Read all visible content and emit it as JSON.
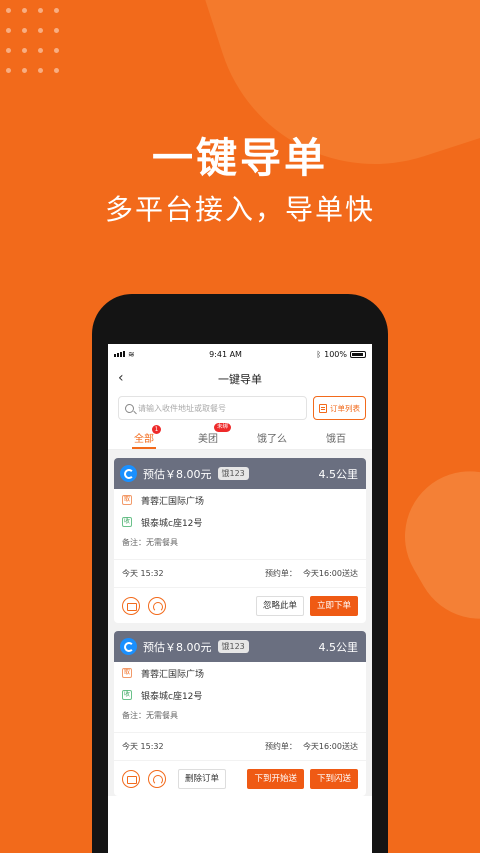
{
  "promo": {
    "headline": "一键导单",
    "subline": "多平台接入，导单快"
  },
  "status_bar": {
    "time": "9:41 AM",
    "battery": "100%"
  },
  "nav": {
    "title": "一键导单"
  },
  "search": {
    "placeholder": "请输入收件地址或取餐号",
    "order_list_label": "订单列表"
  },
  "tabs": [
    {
      "label": "全部",
      "badge": "1",
      "active": true
    },
    {
      "label": "美团",
      "badge": "未绑",
      "active": false
    },
    {
      "label": "饿了么",
      "badge": "",
      "active": false
    },
    {
      "label": "饿百",
      "badge": "",
      "active": false
    }
  ],
  "orders": [
    {
      "estimate": "预估￥8.00元",
      "platform_tag": "饿123",
      "distance": "4.5公里",
      "pickup_address": "菁蓉汇国际广场",
      "dropoff_address": "银泰城c座12号",
      "pickup_icon": "取",
      "dropoff_icon": "收",
      "note": "备注：无需餐具",
      "time": "今天 15:32",
      "reserve_label": "预约单：",
      "reserve_time": "今天16:00送达",
      "buttons": [
        "忽略此单",
        "立即下单"
      ]
    },
    {
      "estimate": "预估￥8.00元",
      "platform_tag": "饿123",
      "distance": "4.5公里",
      "pickup_address": "菁蓉汇国际广场",
      "dropoff_address": "银泰城c座12号",
      "pickup_icon": "取",
      "dropoff_icon": "收",
      "note": "备注：无需餐具",
      "time": "今天 15:32",
      "reserve_label": "预约单：",
      "reserve_time": "今天16:00送达",
      "buttons": [
        "删除订单",
        "下到开始送",
        "下到闪送"
      ]
    }
  ],
  "colors": {
    "brand_orange": "#f26a1b",
    "card_header": "#6a6f80",
    "badge_red": "#ee2a2a"
  },
  "icons": [
    "back-chevron-icon",
    "search-icon",
    "document-icon",
    "printer-icon",
    "refresh-icon",
    "platform-logo-icon",
    "signal-icon",
    "wifi-icon",
    "bluetooth-icon",
    "battery-icon"
  ]
}
